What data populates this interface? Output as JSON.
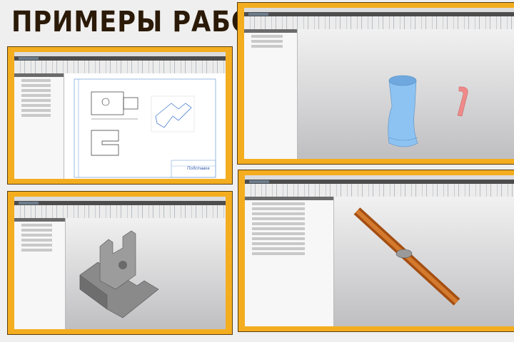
{
  "title": "ПРИМЕРЫ РАБОТ",
  "works": [
    {
      "type": "drawing",
      "stamp_title": "Подставка"
    },
    {
      "type": "3d-model-mug"
    },
    {
      "type": "3d-model-bracket"
    },
    {
      "type": "3d-assembly-pipe"
    }
  ],
  "colors": {
    "frame": "#f3ad1f",
    "title": "#2b1a08",
    "mug": "#8dc3f3",
    "handle": "#f08a8a",
    "pipe": "#c8641a"
  }
}
